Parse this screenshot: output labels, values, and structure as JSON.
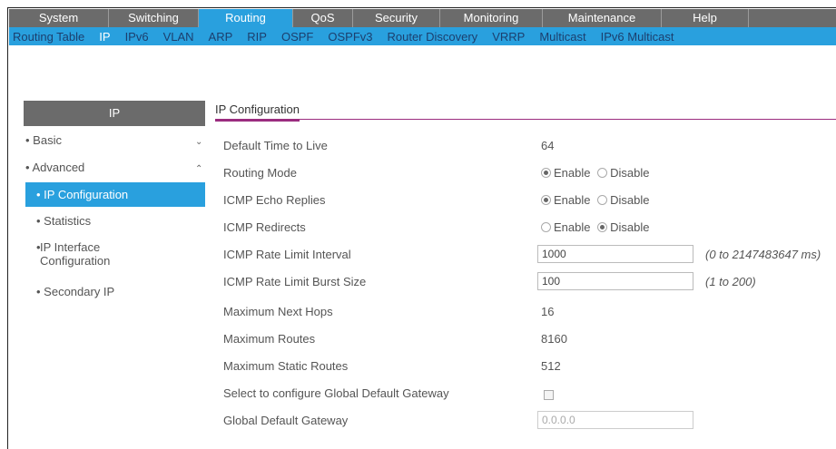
{
  "topnav": [
    "System",
    "Switching",
    "Routing",
    "QoS",
    "Security",
    "Monitoring",
    "Maintenance",
    "Help"
  ],
  "subnav": [
    "Routing Table",
    "IP",
    "IPv6",
    "VLAN",
    "ARP",
    "RIP",
    "OSPF",
    "OSPFv3",
    "Router Discovery",
    "VRRP",
    "Multicast",
    "IPv6 Multicast"
  ],
  "sidebar": {
    "header": "IP",
    "basic": "Basic",
    "advanced": "Advanced",
    "ip_configuration": "IP Configuration",
    "statistics": "Statistics",
    "ip_interface_configuration": "IP Interface Configuration",
    "secondary_ip": "Secondary IP"
  },
  "content": {
    "title": "IP Configuration",
    "default_ttl_label": "Default Time to Live",
    "default_ttl_value": "64",
    "routing_mode_label": "Routing Mode",
    "icmp_echo_label": "ICMP Echo Replies",
    "icmp_redirects_label": "ICMP Redirects",
    "enable": "Enable",
    "disable": "Disable",
    "icmp_rate_interval_label": "ICMP Rate Limit Interval",
    "icmp_rate_interval_value": "1000",
    "icmp_rate_interval_hint": "(0 to 2147483647 ms)",
    "icmp_rate_burst_label": "ICMP Rate Limit Burst Size",
    "icmp_rate_burst_value": "100",
    "icmp_rate_burst_hint": "(1 to 200)",
    "max_next_hops_label": "Maximum Next Hops",
    "max_next_hops_value": "16",
    "max_routes_label": "Maximum Routes",
    "max_routes_value": "8160",
    "max_static_routes_label": "Maximum Static Routes",
    "max_static_routes_value": "512",
    "global_gateway_select_label": "Select to configure Global Default Gateway",
    "global_gateway_label": "Global Default Gateway",
    "global_gateway_value": "0.0.0.0"
  },
  "state": {
    "routing_mode": "Enable",
    "icmp_echo_replies": "Enable",
    "icmp_redirects": "Disable",
    "global_gateway_checked": false
  },
  "colors": {
    "active_blue": "#29a0de",
    "nav_gray": "#6b6b6b",
    "accent_purple": "#9b2c7f"
  }
}
